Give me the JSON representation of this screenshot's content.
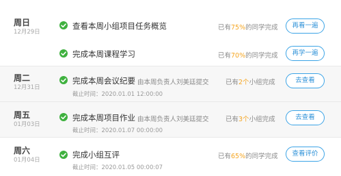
{
  "colors": {
    "accent": "#2f92d8",
    "check": "#3fb13f",
    "highlight": "#f5a623"
  },
  "rows": [
    {
      "day": "周日",
      "date": "12月29日",
      "tasks": [
        {
          "title": "查看本周小组项目任务概览",
          "status_pre": "已有",
          "status_value": "75%",
          "status_post": "的同学完成",
          "button": "再看一遍",
          "icon": "check-circle-icon"
        },
        {
          "title": "完成本周课程学习",
          "status_pre": "已有",
          "status_value": "70%",
          "status_post": "的同学完成",
          "button": "再学一遍",
          "icon": "check-circle-icon"
        }
      ]
    },
    {
      "day": "周二",
      "date": "12月31日",
      "tasks": [
        {
          "title": "完成本周会议纪要",
          "note": "由本周负责人刘美廷提交",
          "deadline": "截止时间：2020.01.01 12:00:00",
          "status_pre": "已有",
          "status_value": "2个",
          "status_post": "小组完成",
          "button": "去查看",
          "icon": "check-circle-icon"
        }
      ]
    },
    {
      "day": "周五",
      "date": "01月03日",
      "tasks": [
        {
          "title": "完成本周项目作业",
          "note": "由本周负责人刘美廷提交",
          "deadline": "截止时间：2020.01.07 00:00:00",
          "status_pre": "已有",
          "status_value": "3个",
          "status_post": "小组完成",
          "button": "去查看",
          "icon": "check-circle-icon"
        }
      ]
    },
    {
      "day": "周六",
      "date": "01月04日",
      "tasks": [
        {
          "title": "完成小组互评",
          "deadline": "截止时间：2020.01.05 00:00:07",
          "status_pre": "已有",
          "status_value": "65%",
          "status_post": "的同学完成",
          "button": "查看评价",
          "icon": "check-circle-icon"
        }
      ]
    }
  ]
}
